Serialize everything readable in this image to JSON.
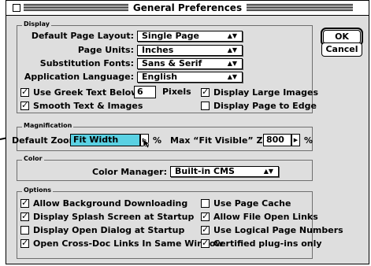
{
  "window": {
    "title": "General Preferences"
  },
  "display": {
    "group_label": "Display",
    "default_page_layout": {
      "label": "Default Page Layout:",
      "value": "Single Page"
    },
    "page_units": {
      "label": "Page Units:",
      "value": "Inches"
    },
    "substitution_fonts": {
      "label": "Substitution Fonts:",
      "value": "Sans & Serif"
    },
    "application_language": {
      "label": "Application Language:",
      "value": "English"
    },
    "greek_text": {
      "label": "Use Greek Text Below:",
      "value": "6",
      "unit": "Pixels",
      "checked": true
    },
    "smooth_text": {
      "label": "Smooth Text & Images",
      "checked": true
    },
    "large_images": {
      "label": "Display Large Images",
      "checked": true
    },
    "page_to_edge": {
      "label": "Display Page to Edge",
      "checked": false
    }
  },
  "magnification": {
    "group_label": "Magnification",
    "default_zoom": {
      "label": "Default Zoom:",
      "value": "Fit Width",
      "unit": "%"
    },
    "max_fit_visible": {
      "label": "Max “Fit Visible” Zoom:",
      "value": "800",
      "unit": "%"
    }
  },
  "color": {
    "group_label": "Color",
    "color_manager": {
      "label": "Color Manager:",
      "value": "Built-in CMS"
    }
  },
  "options": {
    "group_label": "Options",
    "background_downloading": {
      "label": "Allow Background Downloading",
      "checked": true
    },
    "splash_screen": {
      "label": "Display Splash Screen at Startup",
      "checked": true
    },
    "open_dialog": {
      "label": "Display Open Dialog at Startup",
      "checked": false
    },
    "cross_doc_links": {
      "label": "Open Cross-Doc Links In Same Window",
      "checked": true
    },
    "page_cache": {
      "label": "Use Page Cache",
      "checked": false
    },
    "file_open_links": {
      "label": "Allow File Open Links",
      "checked": true
    },
    "logical_page_numbers": {
      "label": "Use Logical Page Numbers",
      "checked": true
    },
    "certified_plugins": {
      "label": "Certified plug-ins only",
      "checked": true
    }
  },
  "buttons": {
    "ok": "OK",
    "cancel": "Cancel"
  }
}
